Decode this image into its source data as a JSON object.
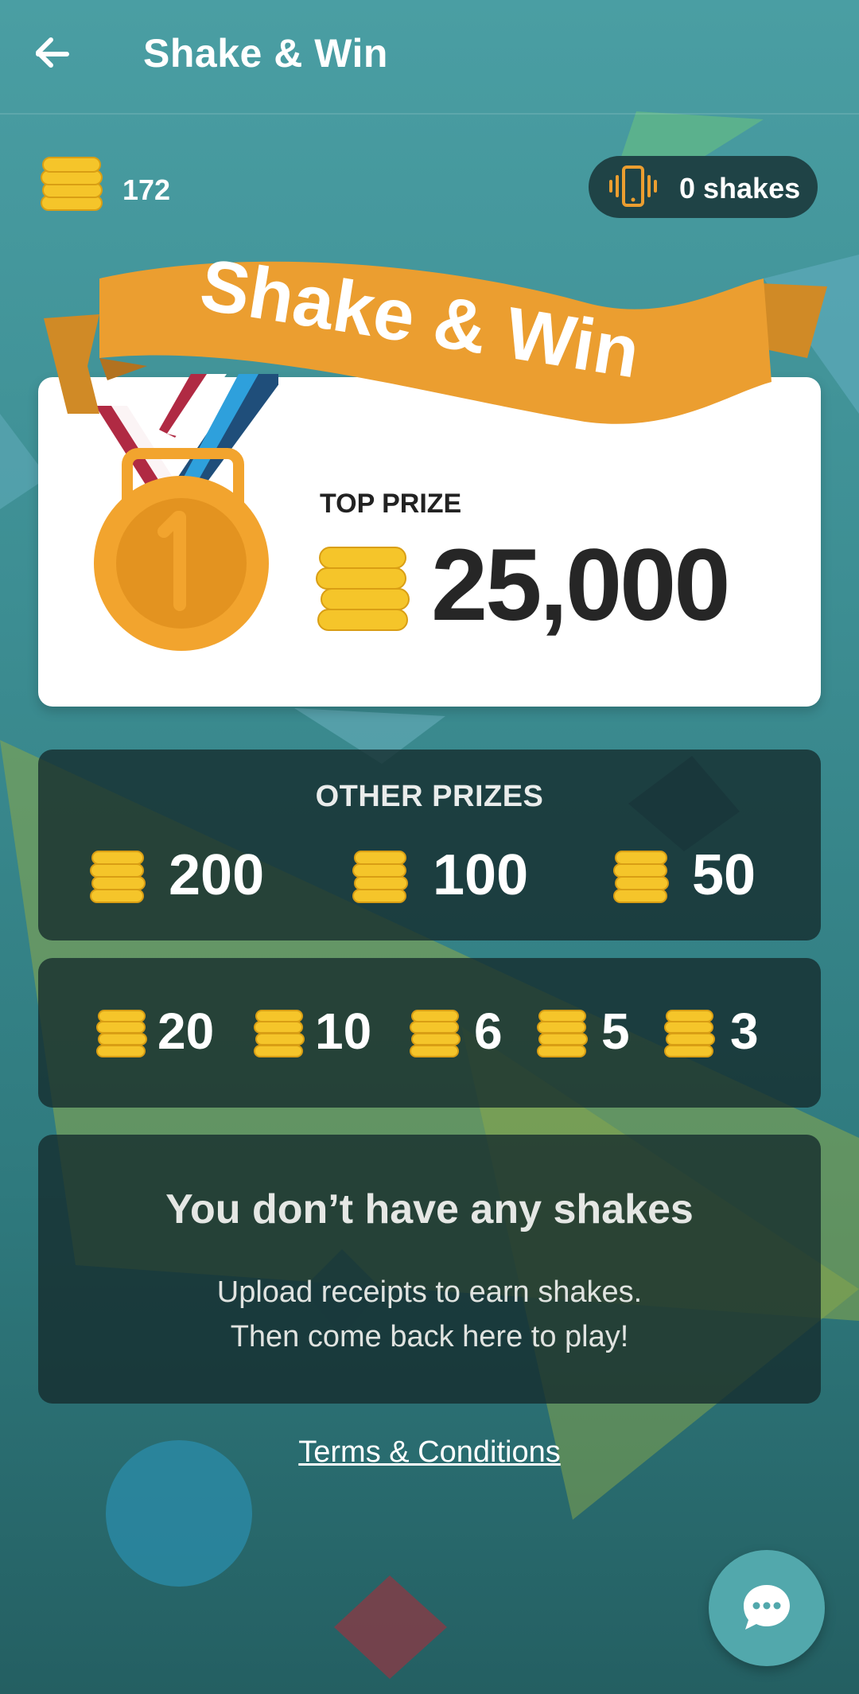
{
  "header": {
    "title": "Shake & Win"
  },
  "balance": {
    "coins": "172"
  },
  "shakes": {
    "label": "0 shakes"
  },
  "banner": {
    "text": "Shake & Win"
  },
  "medal": {
    "rank": "1"
  },
  "top_prize": {
    "label": "TOP PRIZE",
    "value": "25,000"
  },
  "other_prizes": {
    "title": "OTHER PRIZES",
    "large": [
      "200",
      "100",
      "50"
    ],
    "small": [
      "20",
      "10",
      "6",
      "5",
      "3"
    ]
  },
  "message": {
    "title": "You don’t have any shakes",
    "line1": "Upload receipts to earn shakes.",
    "line2": "Then come back here to play!"
  },
  "footer": {
    "terms_label": "Terms & Conditions"
  },
  "colors": {
    "accent": "#eb9e30",
    "coin": "#f5c52a",
    "panel": "#1e3b3d"
  },
  "icons": [
    "back-arrow-icon",
    "coin-stack-icon",
    "phone-shake-icon",
    "medal-icon",
    "chat-icon"
  ]
}
